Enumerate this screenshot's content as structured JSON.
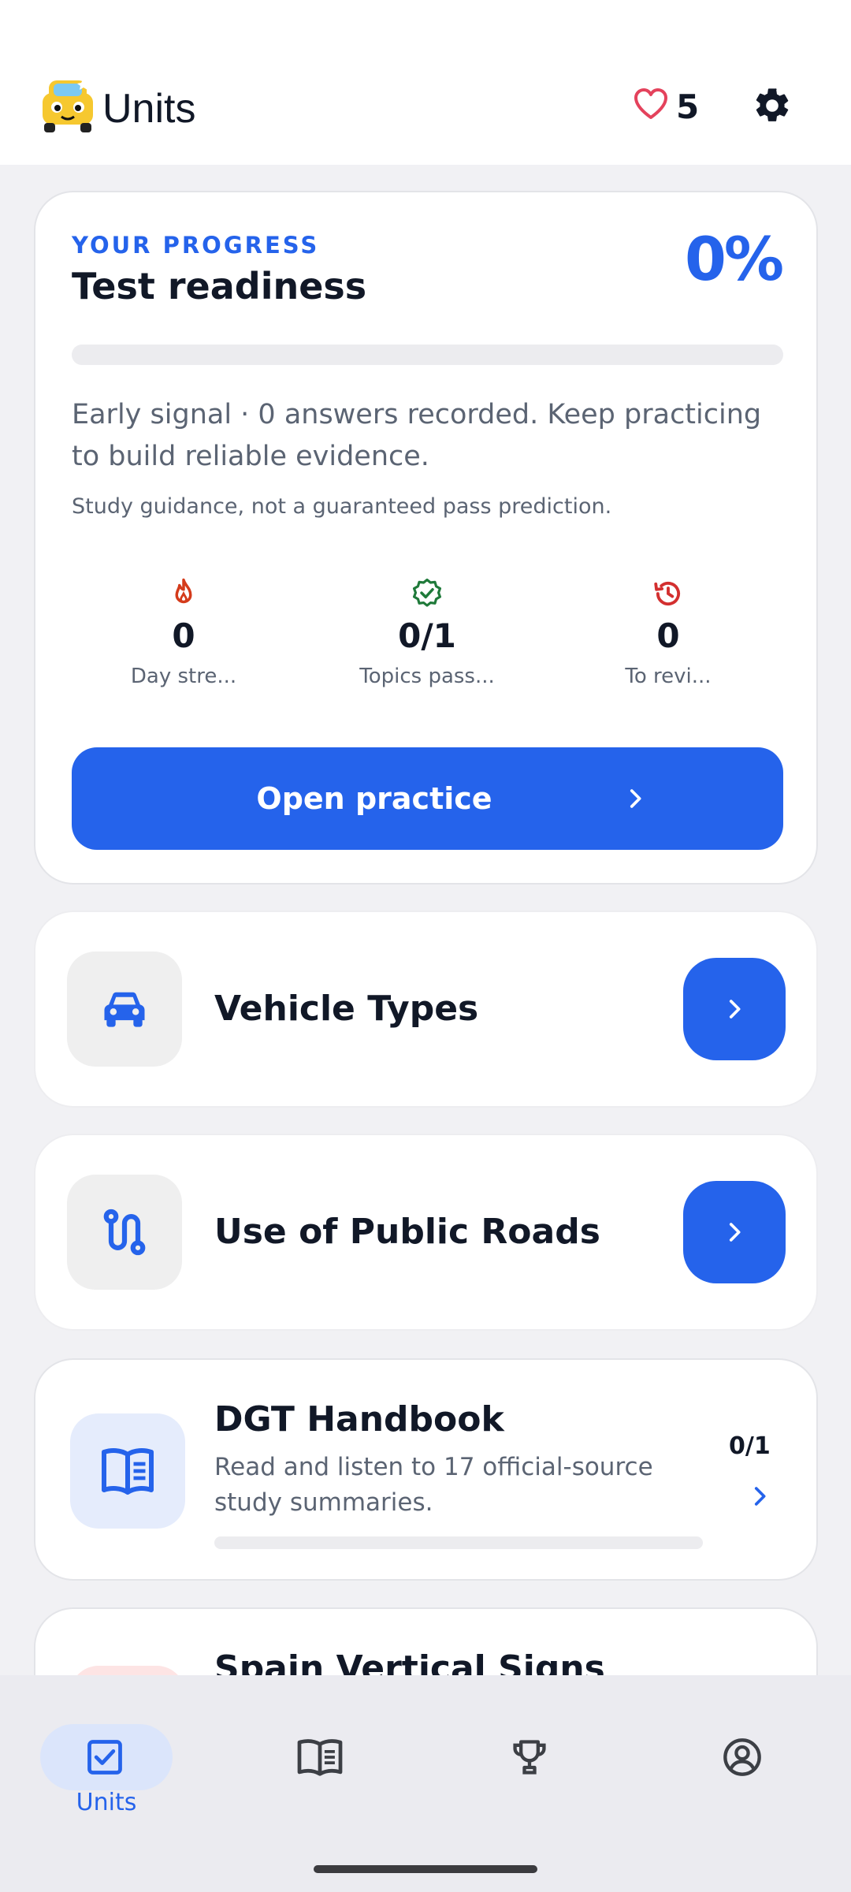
{
  "header": {
    "title": "Units",
    "lives": "5"
  },
  "progress": {
    "eyebrow": "YOUR PROGRESS",
    "title": "Test readiness",
    "percent_label": "0%",
    "percent_value": 0,
    "signal_text": "Early signal · 0 answers recorded. Keep practicing to build reliable evidence.",
    "disclaimer": "Study guidance, not a guaranteed pass prediction.",
    "stats": [
      {
        "icon": "flame-icon",
        "value": "0",
        "label": "Day stre..."
      },
      {
        "icon": "verified-badge-icon",
        "value": "0/1",
        "label": "Topics pass..."
      },
      {
        "icon": "history-icon",
        "value": "0",
        "label": "To revi..."
      }
    ],
    "cta_label": "Open practice"
  },
  "units": [
    {
      "title": "Vehicle Types",
      "icon": "car-icon"
    },
    {
      "title": "Use of Public Roads",
      "icon": "route-icon"
    }
  ],
  "handbook": {
    "title": "DGT Handbook",
    "description": "Read and listen to 17 official-source study summaries.",
    "count": "0/1",
    "progress_value": 0
  },
  "next_unit": {
    "title": "Spain Vertical Signs"
  },
  "nav": {
    "items": [
      {
        "label": "Units",
        "icon": "checkbox-icon",
        "active": true
      },
      {
        "label": "",
        "icon": "book-icon"
      },
      {
        "label": "",
        "icon": "trophy-icon"
      },
      {
        "label": "",
        "icon": "profile-icon"
      }
    ]
  },
  "colors": {
    "accent": "#2563eb",
    "flame": "#d43b1b",
    "badge": "#1f7a3a",
    "history": "#d32f2f"
  }
}
